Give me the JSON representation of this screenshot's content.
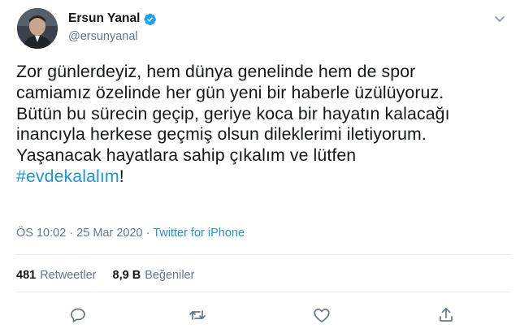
{
  "user": {
    "display_name": "Ersun Yanal",
    "handle": "@ersunyanal",
    "verified": true
  },
  "tweet": {
    "lines": [
      "Zor günlerdeyiz, hem dünya genelinde hem de spor",
      "camiamız özelinde her gün yeni bir haberle üzülüyoruz.",
      "Bütün bu sürecin geçip, geriye koca bir hayatın kalacağı",
      "inancıyla herkese geçmiş olsun dileklerimi iletiyorum.",
      "Yaşanacak hayatlara sahip çıkalım ve lütfen"
    ],
    "hashtag": "#evdekalalım",
    "trailing": "!"
  },
  "meta": {
    "time": "ÖS 10:02",
    "separator": " · ",
    "date": "25 Mar 2020",
    "source": "Twitter for iPhone"
  },
  "stats": {
    "retweets_count": "481",
    "retweets_label": "Retweetler",
    "likes_count": "8,9 B",
    "likes_label": "Beğeniler"
  },
  "icons": {
    "avatar": "profile-photo",
    "verified": "verified-badge-icon",
    "menu": "chevron-down-icon",
    "reply": "reply-icon",
    "retweet": "retweet-icon",
    "like": "heart-icon",
    "share": "share-icon"
  },
  "colors": {
    "accent": "#1b95e0",
    "text": "#14171a",
    "muted": "#657786",
    "divider": "#e6ecf0"
  }
}
